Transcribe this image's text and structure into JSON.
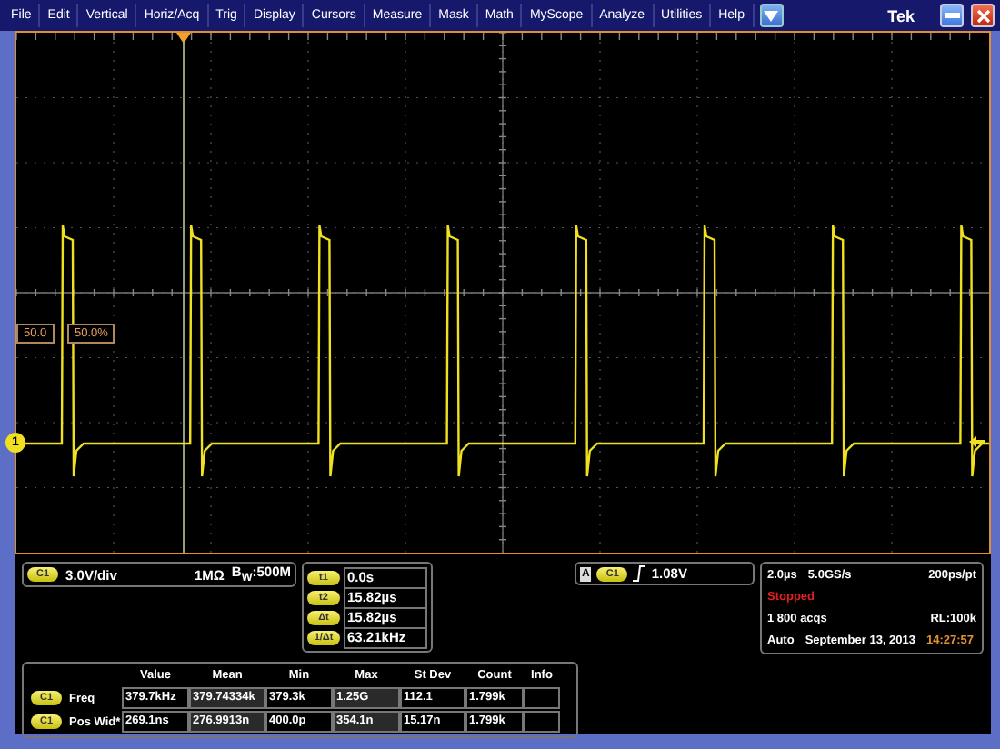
{
  "menu": {
    "items": [
      "File",
      "Edit",
      "Vertical",
      "Horiz/Acq",
      "Trig",
      "Display",
      "Cursors",
      "Measure",
      "Mask",
      "Math",
      "MyScope",
      "Analyze",
      "Utilities",
      "Help"
    ],
    "brand": "Tek"
  },
  "screen": {
    "ref_level": "50.0",
    "percent": "50.0%",
    "channel_marker": "1"
  },
  "channel_readout": {
    "badge": "C1",
    "scale": "3.0V/div",
    "impedance": "1MΩ",
    "bandwidth": "B$_{W}$:500M"
  },
  "cursors": [
    {
      "label": "t1",
      "value": "0.0s"
    },
    {
      "label": "t2",
      "value": "15.82µs"
    },
    {
      "label": "Δt",
      "value": "15.82µs"
    },
    {
      "label": "1/Δt",
      "value": "63.21kHz"
    }
  ],
  "trigger": {
    "source_tag": "A",
    "badge": "C1",
    "level": "1.08V"
  },
  "acquisition": {
    "timebase": "2.0µs",
    "sample_rate": "5.0GS/s",
    "resolution": "200ps/pt",
    "status": "Stopped",
    "acqs": "1 800 acqs",
    "record_length": "RL:100k",
    "mode": "Auto",
    "date": "September 13, 2013",
    "time": "14:27:57"
  },
  "measurements": {
    "columns": [
      "Value",
      "Mean",
      "Min",
      "Max",
      "St Dev",
      "Count",
      "Info"
    ],
    "rows": [
      {
        "badge": "C1",
        "name": "Freq",
        "cells": [
          "379.7kHz",
          "379.74334k",
          "379.3k",
          "1.25G",
          "112.1",
          "1.799k"
        ]
      },
      {
        "badge": "C1",
        "name": "Pos Wid*",
        "cells": [
          "269.1ns",
          "276.9913n",
          "400.0p",
          "354.1n",
          "15.17n",
          "1.799k"
        ]
      }
    ]
  }
}
